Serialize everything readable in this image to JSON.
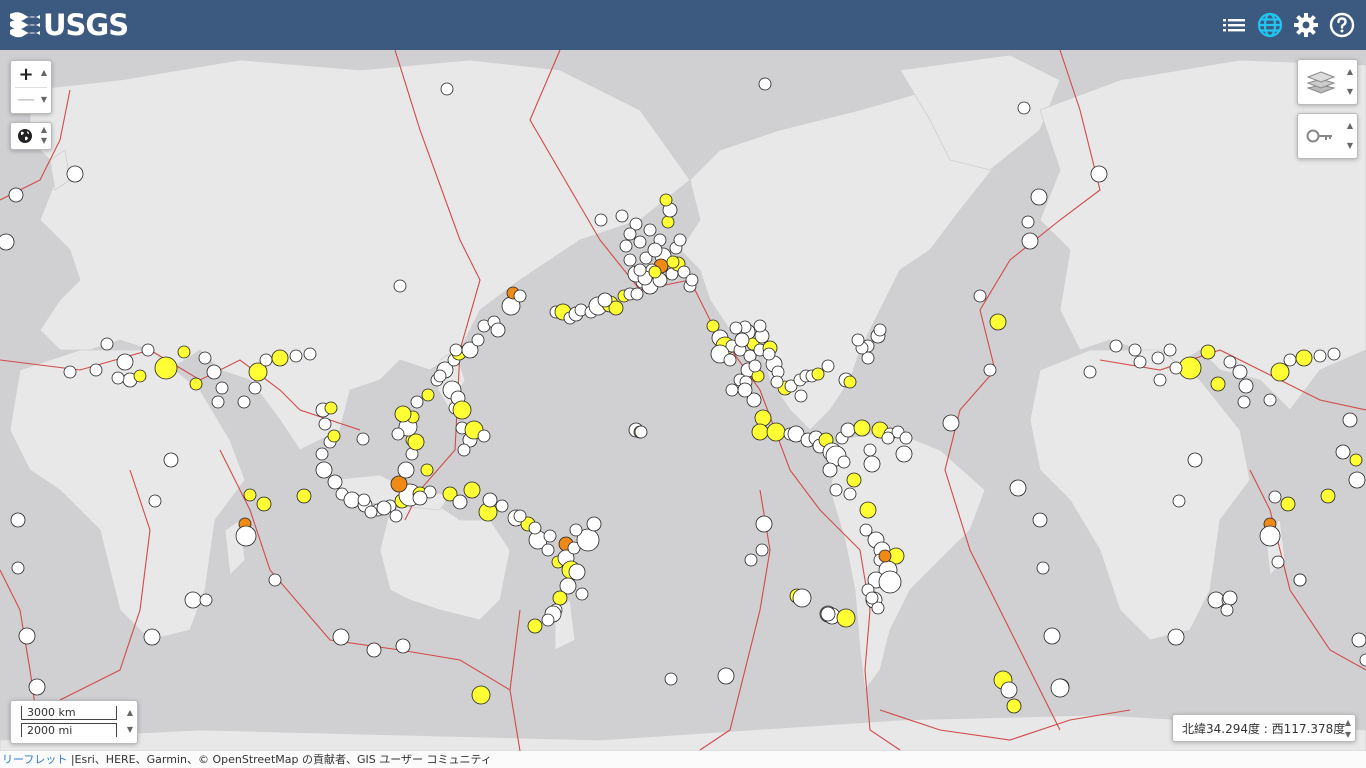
{
  "header": {
    "logo_text": "USGS",
    "icons": [
      "list-icon",
      "globe-icon",
      "gear-icon",
      "help-icon"
    ],
    "background": "#3c5a80",
    "active_icon_color": "#22c5f0"
  },
  "map_controls": {
    "zoom_in": "+",
    "zoom_out": "—"
  },
  "scale": {
    "km": "3000 km",
    "mi": "2000 mi"
  },
  "coordinates": "北緯34.294度 : 西117.378度",
  "attribution": {
    "link": "リーフレット",
    "text": " |Esri、HERE、Garmin、© OpenStreetMap の貢献者、GIS ユーザー コミュニティ"
  },
  "legend_colors": {
    "older": "#ffffff",
    "past_day": "#ffff33",
    "past_hour": "#f08a17"
  }
}
